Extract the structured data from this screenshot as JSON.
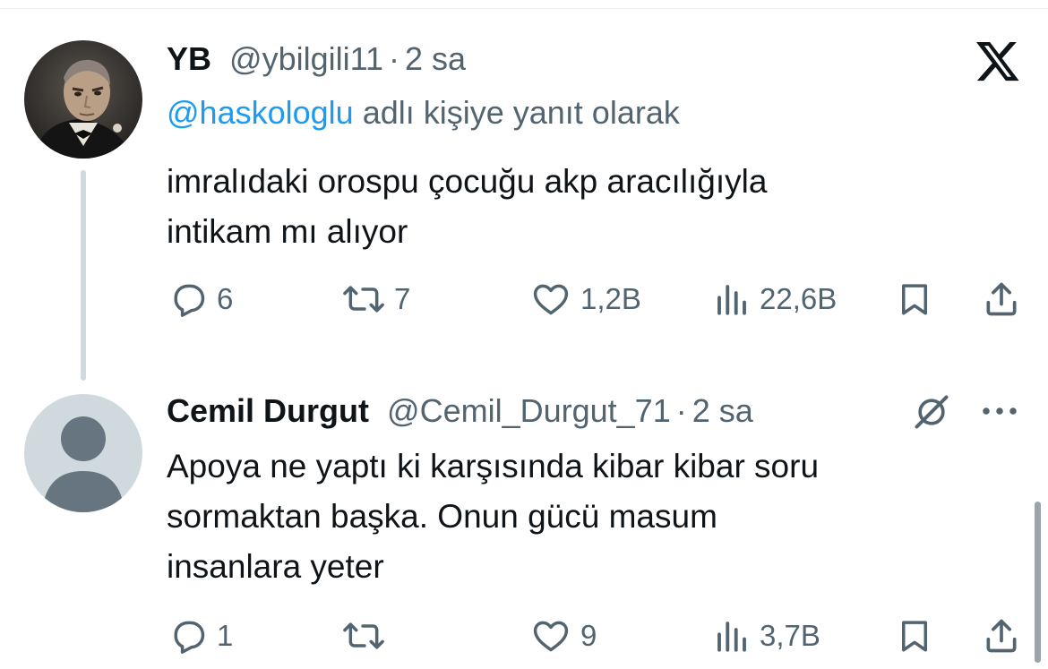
{
  "tweets": [
    {
      "name": "YB",
      "handle": "@ybilgili11",
      "separator": "·",
      "time": "2 sa",
      "replying_mention": "@haskologlu",
      "replying_text": "adlı kişiye yanıt olarak",
      "text_lines": [
        "imralıdaki orospu çocuğu akp aracılığıyla",
        "intikam mı alıyor"
      ],
      "replies": "6",
      "retweets": "7",
      "likes": "1,2B",
      "views": "22,6B"
    },
    {
      "name": "Cemil Durgut",
      "handle": "@Cemil_Durgut_71",
      "separator": "·",
      "time": "2 sa",
      "text_lines": [
        "Apoya ne yaptı ki karşısında kibar kibar soru",
        "sormaktan başka. Onun gücü masum",
        "insanlara yeter"
      ],
      "replies": "1",
      "retweets": "",
      "likes": "9",
      "views": "3,7B"
    }
  ],
  "icons": {
    "app_logo": "x-logo-icon",
    "reply": "reply-icon",
    "retweet": "retweet-icon",
    "like": "heart-icon",
    "views": "views-icon",
    "bookmark": "bookmark-icon",
    "share": "share-icon",
    "grok": "grok-icon",
    "more": "more-icon"
  },
  "colors": {
    "link": "#1d9bf0",
    "secondary_text": "#536471",
    "primary_text": "#0f1419",
    "thread_line": "#cfd9de"
  }
}
